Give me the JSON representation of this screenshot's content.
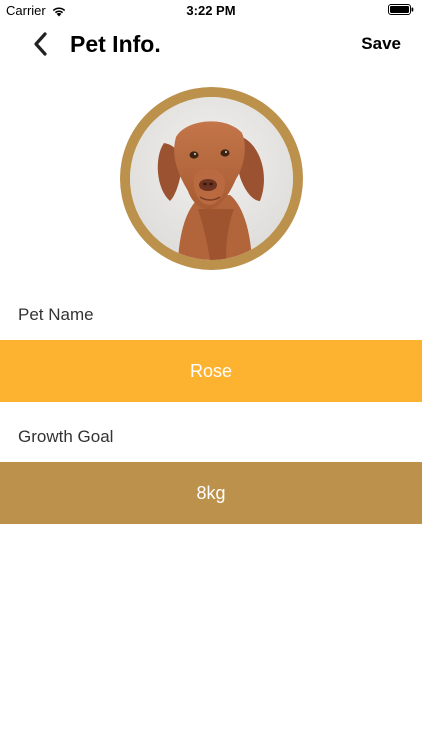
{
  "status_bar": {
    "carrier": "Carrier",
    "time": "3:22 PM",
    "icons": [
      "wifi-icon",
      "battery-icon"
    ]
  },
  "nav": {
    "back_icon": "chevron-left-icon",
    "title": "Pet Info.",
    "save_label": "Save"
  },
  "pet_photo": {
    "ring_color": "#bb914c"
  },
  "fields": {
    "pet_name": {
      "label": "Pet Name",
      "value": "Rose",
      "bg_color": "#fdb330"
    },
    "growth_goal": {
      "label": "Growth Goal",
      "value": "8kg",
      "bg_color": "#bb914c"
    }
  }
}
